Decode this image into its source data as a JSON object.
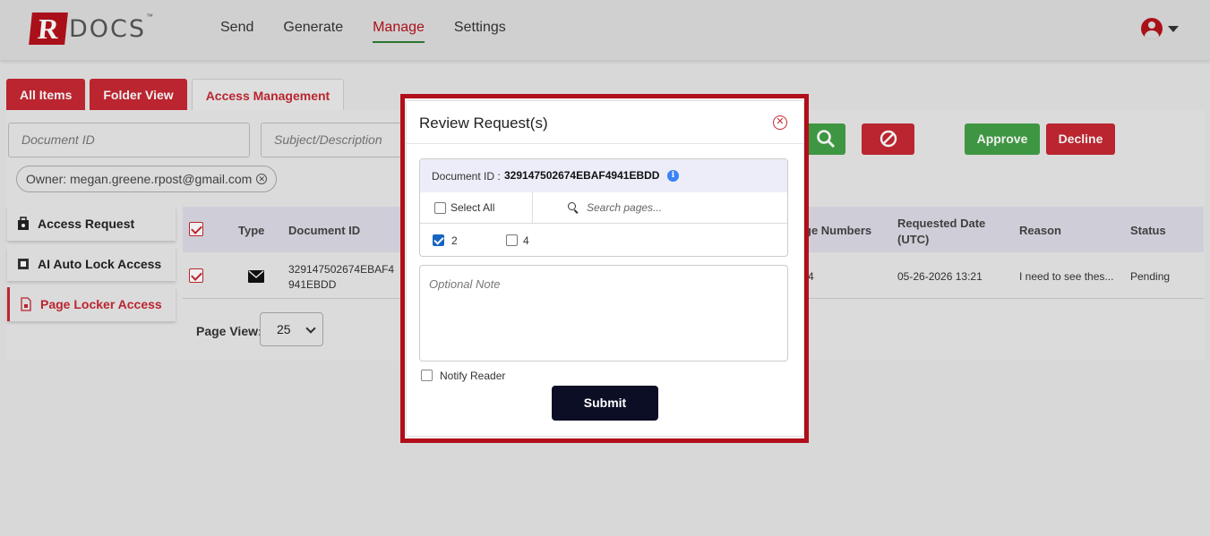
{
  "header": {
    "logo_letter": "R",
    "logo_text": "DOCS",
    "logo_tm": "™",
    "nav": [
      "Send",
      "Generate",
      "Manage",
      "Settings"
    ]
  },
  "tabs": [
    "All Items",
    "Folder View",
    "Access Management"
  ],
  "filters": {
    "doc_id_placeholder": "Document ID",
    "subject_placeholder": "Subject/Description",
    "owner_chip": "Owner: megan.greene.rpost@gmail.com"
  },
  "actions": {
    "approve": "Approve",
    "decline": "Decline"
  },
  "colors": {
    "brand_red": "#c62832",
    "approve_green": "#43a047",
    "submit_navy": "#0b0e24"
  },
  "side": [
    "Access Request",
    "AI Auto Lock Access",
    "Page Locker Access"
  ],
  "table": {
    "headers": [
      "Type",
      "Document ID",
      "ge Numbers",
      "Requested Date\n(UTC)",
      "Reason",
      "Status"
    ],
    "row": {
      "doc_id_line1": "329147502674EBAF4",
      "doc_id_line2": "941EBDD",
      "page_num": "4",
      "date": "05-26-2026 13:21",
      "reason": "I need to see thes...",
      "status": "Pending"
    }
  },
  "page_view": {
    "label": "Page View:",
    "value": "25"
  },
  "modal": {
    "title": "Review Request(s)",
    "doc_label": "Document ID :",
    "doc_id": "329147502674EBAF4941EBDD",
    "select_all": "Select All",
    "search_placeholder": "Search pages...",
    "pages": [
      {
        "num": "2",
        "checked": true
      },
      {
        "num": "4",
        "checked": false
      }
    ],
    "note_placeholder": "Optional Note",
    "notify": "Notify Reader",
    "submit": "Submit"
  }
}
